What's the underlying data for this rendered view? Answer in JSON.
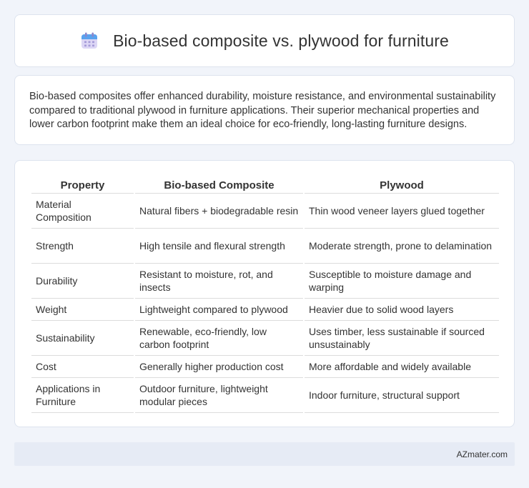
{
  "header": {
    "title": "Bio-based composite vs. plywood for furniture",
    "icon": "calendar-icon"
  },
  "summary": {
    "text": "Bio-based composites offer enhanced durability, moisture resistance, and environmental sustainability compared to traditional plywood in furniture applications. Their superior mechanical properties and lower carbon footprint make them an ideal choice for eco-friendly, long-lasting furniture designs."
  },
  "table": {
    "headers": [
      "Property",
      "Bio-based Composite",
      "Plywood"
    ],
    "rows": [
      [
        "Material Composition",
        "Natural fibers + biodegradable resin",
        "Thin wood veneer layers glued together"
      ],
      [
        "Strength",
        "High tensile and flexural strength",
        "Moderate strength, prone to delamination"
      ],
      [
        "Durability",
        "Resistant to moisture, rot, and insects",
        "Susceptible to moisture damage and warping"
      ],
      [
        "Weight",
        "Lightweight compared to plywood",
        "Heavier due to solid wood layers"
      ],
      [
        "Sustainability",
        "Renewable, eco-friendly, low carbon footprint",
        "Uses timber, less sustainable if sourced unsustainably"
      ],
      [
        "Cost",
        "Generally higher production cost",
        "More affordable and widely available"
      ],
      [
        "Applications in Furniture",
        "Outdoor furniture, lightweight modular pieces",
        "Indoor furniture, structural support"
      ]
    ]
  },
  "footer": {
    "text": "AZmater.com"
  }
}
